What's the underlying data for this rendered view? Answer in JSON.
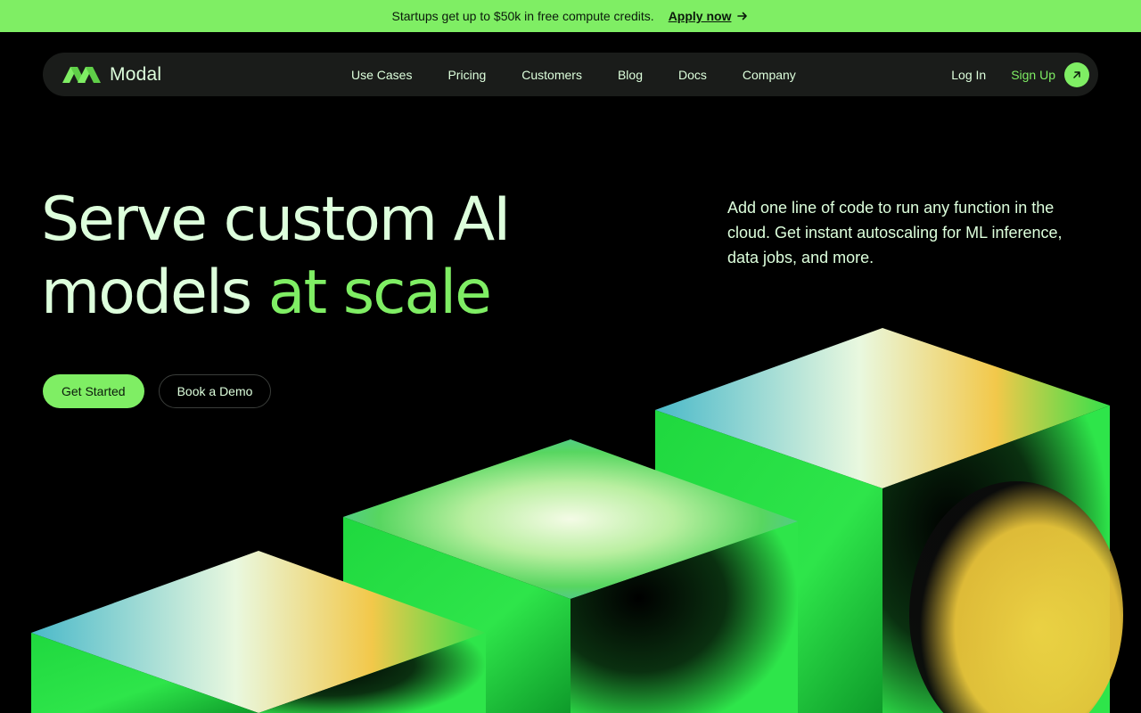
{
  "banner": {
    "text": "Startups get up to $50k in free compute credits.",
    "link_label": "Apply now",
    "arrow_icon": "arrow-right-icon"
  },
  "nav": {
    "brand": "Modal",
    "logo_icon": "modal-logo-icon",
    "links": [
      "Use Cases",
      "Pricing",
      "Customers",
      "Blog",
      "Docs",
      "Company"
    ],
    "login_label": "Log In",
    "signup_label": "Sign Up",
    "signup_icon": "arrow-up-right-icon"
  },
  "hero": {
    "headline_line1": "Serve custom AI",
    "headline_line2": "models",
    "headline_accent": "at scale",
    "subtext": "Add one line of code to run any function in the cloud. Get instant autoscaling for ML inference, data jobs, and more.",
    "primary_cta": "Get Started",
    "secondary_cta": "Book a Demo",
    "illustration_icon": "isometric-cubes-illustration"
  },
  "colors": {
    "accent": "#7fee64",
    "background": "#000000",
    "text": "#ddffdc",
    "nav_background": "#1a1c1a"
  }
}
